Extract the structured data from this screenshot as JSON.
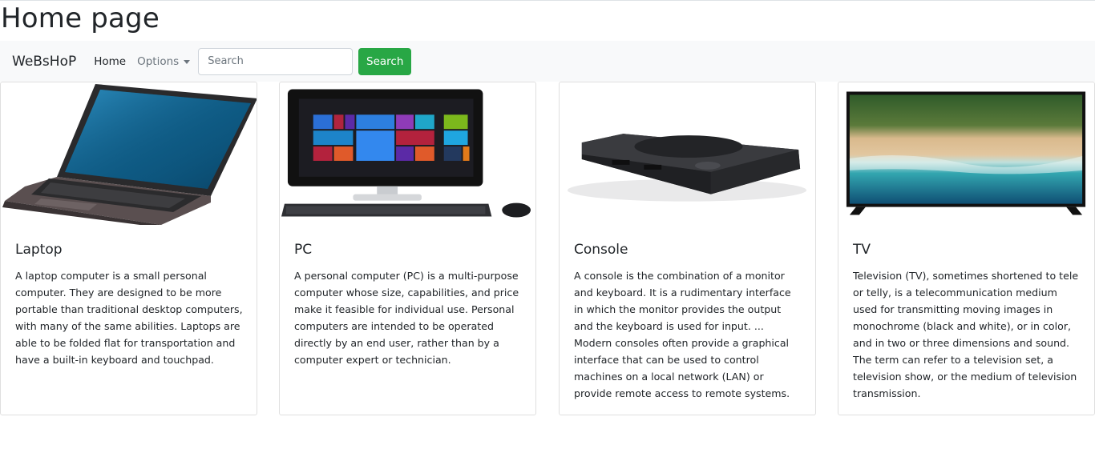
{
  "page": {
    "title": "Home page"
  },
  "navbar": {
    "brand": "WeBsHoP",
    "home_label": "Home",
    "options_label": "Options",
    "search_placeholder": "Search",
    "search_button_label": "Search"
  },
  "products": [
    {
      "title": "Laptop",
      "image_icon": "laptop-image",
      "text": "A laptop computer is a small personal computer. They are designed to be more portable than traditional desktop computers, with many of the same abilities. Laptops are able to be folded flat for transportation and have a built-in keyboard and touchpad."
    },
    {
      "title": "PC",
      "image_icon": "desktop-pc-image",
      "text": "A personal computer (PC) is a multi-purpose computer whose size, capabilities, and price make it feasible for individual use. Personal computers are intended to be operated directly by an end user, rather than by a computer expert or technician."
    },
    {
      "title": "Console",
      "image_icon": "game-console-image",
      "text": "A console is the combination of a monitor and keyboard. It is a rudimentary interface in which the monitor provides the output and the keyboard is used for input. ... Modern consoles often provide a graphical interface that can be used to control machines on a local network (LAN) or provide remote access to remote systems."
    },
    {
      "title": "TV",
      "image_icon": "television-image",
      "text": "Television (TV), sometimes shortened to tele or telly, is a telecommunication medium used for transmitting moving images in monochrome (black and white), or in color, and in two or three dimensions and sound. The term can refer to a television set, a television show, or the medium of television transmission."
    }
  ],
  "colors": {
    "navbar_bg": "#f8f9fa",
    "search_button": "#28a745",
    "card_border": "#dfdfdf"
  }
}
